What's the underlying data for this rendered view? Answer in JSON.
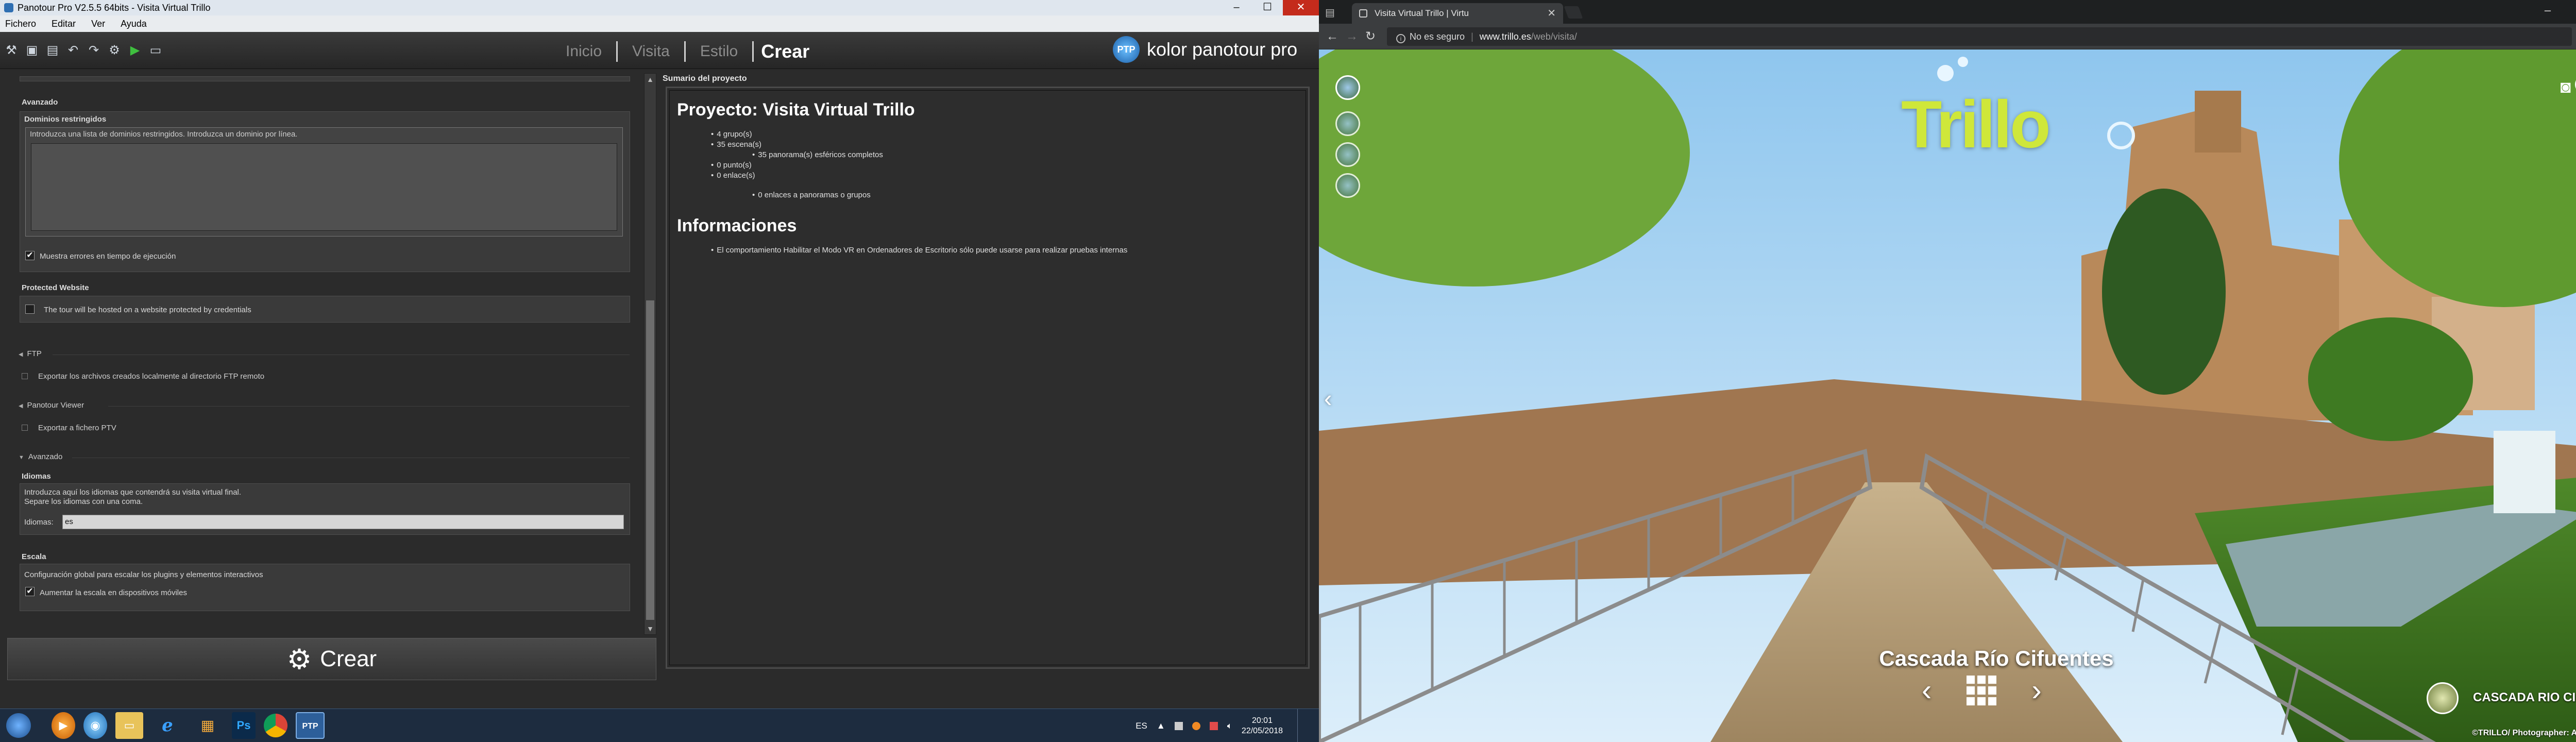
{
  "panotour": {
    "window_title": "Panotour Pro V2.5.5 64bits - Visita Virtual Trillo",
    "menu": [
      "Fichero",
      "Editar",
      "Ver",
      "Ayuda"
    ],
    "nav": {
      "inicio": "Inicio",
      "visita": "Visita",
      "estilo": "Estilo",
      "crear": "Crear"
    },
    "brand": {
      "logo": "PTP",
      "name": "kolor panotour pro"
    },
    "settings": {
      "avanzado_top": "Avanzado",
      "dominios_title": "Dominios restringidos",
      "dominios_placeholder": "Introduzca una lista de dominios restringidos. Introduzca un dominio por línea.",
      "mostrar_errores": "Muestra errores en tiempo de ejecución",
      "protected_title": "Protected Website",
      "protected_label": "The tour will be hosted on a website protected by credentials",
      "ftp_title": "FTP",
      "ftp_label": "Exportar los archivos creados localmente al directorio FTP remoto",
      "viewer_title": "Panotour Viewer",
      "viewer_label": "Exportar a fichero PTV",
      "avanzado_title": "Avanzado",
      "idiomas_title": "Idiomas",
      "idiomas_desc_1": "Introduzca aquí los idiomas que contendrá su visita virtual final.",
      "idiomas_desc_2": "Separe los idiomas con una coma.",
      "idiomas_label": "Idiomas:",
      "idiomas_value": "es",
      "escala_title": "Escala",
      "escala_desc": "Configuración global para escalar los plugins y elementos interactivos",
      "escala_label": "Aumentar la escala en dispositivos móviles"
    },
    "create_button": "Crear",
    "summary": {
      "panel_label": "Sumario del proyecto",
      "project_heading": "Proyecto: Visita Virtual Trillo",
      "items": [
        "4 grupo(s)",
        "35 escena(s)",
        "35 panorama(s) esféricos completos",
        "0 punto(s)",
        "0 enlace(s)",
        "0 enlaces a panoramas o grupos"
      ],
      "info_heading": "Informaciones",
      "info_items": [
        "El comportamiento Habilitar el Modo VR en Ordenadores de Escritorio sólo puede usarse para realizar pruebas internas"
      ]
    }
  },
  "taskbar": {
    "apps": [
      "windows-start",
      "media-player",
      "browser-ie",
      "file-explorer",
      "internet-explorer",
      "apps-grid",
      "photoshop",
      "chrome",
      "panotour"
    ],
    "ps_label": "Ps",
    "ptp_label": "PTP",
    "lang": "ES",
    "time": "20:01",
    "date": "22/05/2018"
  },
  "chrome": {
    "tab_title": "Visita Virtual Trillo | Virtu",
    "url_insecure": "No es seguro",
    "url_host": "www.trillo.es",
    "url_path": "/web/visita/",
    "tour": {
      "logo": "Trillo",
      "scene_title": "Cascada Río Cifuentes",
      "bottom_label": "CASCADA RIO CIFUEN...",
      "credit": "©TRILLO/ Photographer: Alberto Cerrato"
    }
  },
  "colors": {
    "panotour_bg": "#2b2b2b",
    "taskbar_bg": "#1d2c3f",
    "chrome_bar": "#3b3d3f",
    "logo_green": "#cfe73a"
  }
}
